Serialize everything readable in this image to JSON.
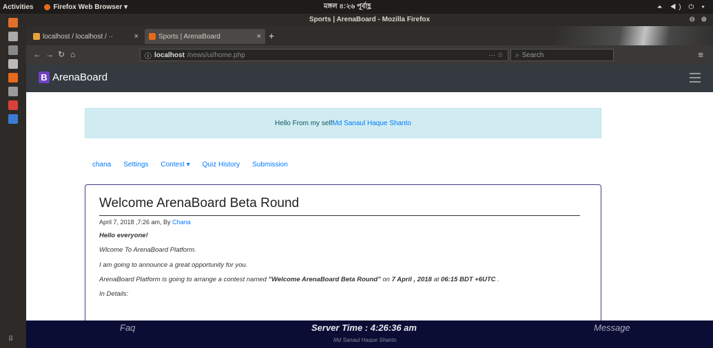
{
  "topbar": {
    "activities": "Activities",
    "app_name": "Firefox Web Browser ▾",
    "clock": "মঙ্গল ৪:২৬ পূর্বাহ্ণ",
    "tray": "⏶ ◀) ⏻ ▾"
  },
  "window": {
    "title": "Sports | ArenaBoard - Mozilla Firefox",
    "controls": "⊖ ⊗"
  },
  "tabs": [
    {
      "label": "localhost / localhost / ··",
      "close": "×",
      "favicon_color": "#e8a23c"
    },
    {
      "label": "Sports | ArenaBoard",
      "close": "×",
      "favicon_color": "#e66a1b"
    }
  ],
  "newtab": "+",
  "nav": {
    "back": "←",
    "forward": "→",
    "reload": "↻",
    "home": "⌂",
    "url_host": "localhost",
    "url_path": "/news/ui/home.php",
    "more": "··· ☆",
    "search_placeholder": "Search",
    "menu": "≡"
  },
  "site": {
    "brand_letter": "B",
    "brand": "ArenaBoard"
  },
  "alert": {
    "prefix": "Hello From my self ",
    "name": "Md Sanaul Haque Shanto"
  },
  "menu": [
    "chana",
    "Settings",
    "Contest ▾",
    "Quiz History",
    "Submission"
  ],
  "post": {
    "title": "Welcome ArenaBoard Beta Round",
    "meta_prefix": "April 7, 2018 ,7:26 am, By ",
    "meta_author": "Chana",
    "greeting": "Hello everyone!",
    "line1": "Wlcome To ArenaBoard Platform.",
    "line2": "I am going to announce a great opportunity for you.",
    "line3_a": "ArenaBoard Platform is going to arrange a contest named ",
    "line3_contest": "\"Welcome ArenaBoard Beta Round\"",
    "line3_b": " on ",
    "line3_date": "7 April , 2018",
    "line3_c": " at ",
    "line3_time": "06:15 BDT +6UTC",
    "line3_d": " .",
    "line4": "In Details:"
  },
  "footer": {
    "faq": "Faq",
    "server_time": "Server Time : 4:26:36 am",
    "message": "Message",
    "credit": "Md Sanaul Haque Shanto"
  },
  "dock_icons": [
    {
      "name": "ubuntu-software-icon",
      "color": "#e2702b"
    },
    {
      "name": "files-icon",
      "color": "#aaa"
    },
    {
      "name": "terminal-icon",
      "color": "#888"
    },
    {
      "name": "mail-icon",
      "color": "#bbb"
    },
    {
      "name": "firefox-icon",
      "color": "#e66a1b"
    },
    {
      "name": "text-editor-icon",
      "color": "#9a9a9a"
    },
    {
      "name": "chrome-icon",
      "color": "#d9403a"
    },
    {
      "name": "writer-icon",
      "color": "#3a7bd5"
    }
  ]
}
